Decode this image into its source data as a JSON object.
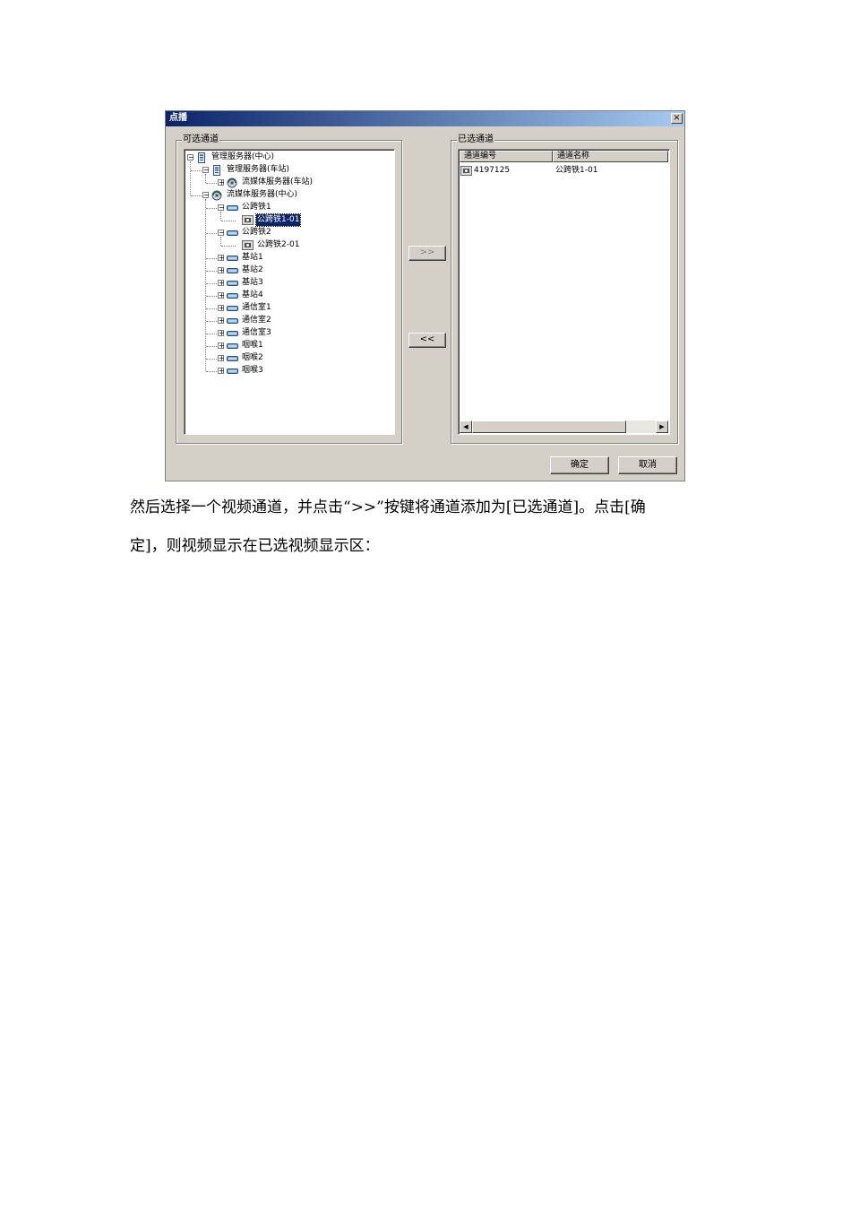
{
  "dialog": {
    "title": "点播",
    "close_glyph": "×",
    "left_group_title": "可选通道",
    "right_group_title": "已选通道",
    "add_button": ">>",
    "remove_button": "<<",
    "ok_button": "确定",
    "cancel_button": "取消",
    "tree": [
      {
        "label": "管理服务器(中心)",
        "level": 0,
        "expander": "−",
        "icon": "server-icon"
      },
      {
        "label": "管理服务器(车站)",
        "level": 1,
        "expander": "−",
        "icon": "server-icon"
      },
      {
        "label": "流媒体服务器(车站)",
        "level": 2,
        "expander": "+",
        "icon": "media-server-icon"
      },
      {
        "label": "流媒体服务器(中心)",
        "level": 1,
        "expander": "−",
        "icon": "media-server-icon"
      },
      {
        "label": "公跨铁1",
        "level": 2,
        "expander": "−",
        "icon": "device-icon"
      },
      {
        "label": "公跨铁1-01",
        "level": 3,
        "expander": "",
        "icon": "camera-icon",
        "selected": true
      },
      {
        "label": "公跨铁2",
        "level": 2,
        "expander": "−",
        "icon": "device-icon"
      },
      {
        "label": "公跨铁2-01",
        "level": 3,
        "expander": "",
        "icon": "camera-icon"
      },
      {
        "label": "基站1",
        "level": 2,
        "expander": "+",
        "icon": "device-icon"
      },
      {
        "label": "基站2",
        "level": 2,
        "expander": "+",
        "icon": "device-icon"
      },
      {
        "label": "基站3",
        "level": 2,
        "expander": "+",
        "icon": "device-icon"
      },
      {
        "label": "基站4",
        "level": 2,
        "expander": "+",
        "icon": "device-icon"
      },
      {
        "label": "通信室1",
        "level": 2,
        "expander": "+",
        "icon": "device-icon"
      },
      {
        "label": "通信室2",
        "level": 2,
        "expander": "+",
        "icon": "device-icon"
      },
      {
        "label": "通信室3",
        "level": 2,
        "expander": "+",
        "icon": "device-icon"
      },
      {
        "label": "咽喉1",
        "level": 2,
        "expander": "+",
        "icon": "device-icon"
      },
      {
        "label": "咽喉2",
        "level": 2,
        "expander": "+",
        "icon": "device-icon"
      },
      {
        "label": "咽喉3",
        "level": 2,
        "expander": "+",
        "icon": "device-icon"
      }
    ],
    "list_columns": [
      "通道编号",
      "通道名称"
    ],
    "list_rows": [
      {
        "id": "4197125",
        "name": "公跨铁1-01",
        "icon": "camera-icon"
      }
    ],
    "scroll_left": "◀",
    "scroll_right": "▶"
  },
  "paragraphs": [
    "然后选择一个视频通道，并点击“>>”按键将通道添加为[已选通道]。点击[确",
    "定]，则视频显示在已选视频显示区："
  ]
}
